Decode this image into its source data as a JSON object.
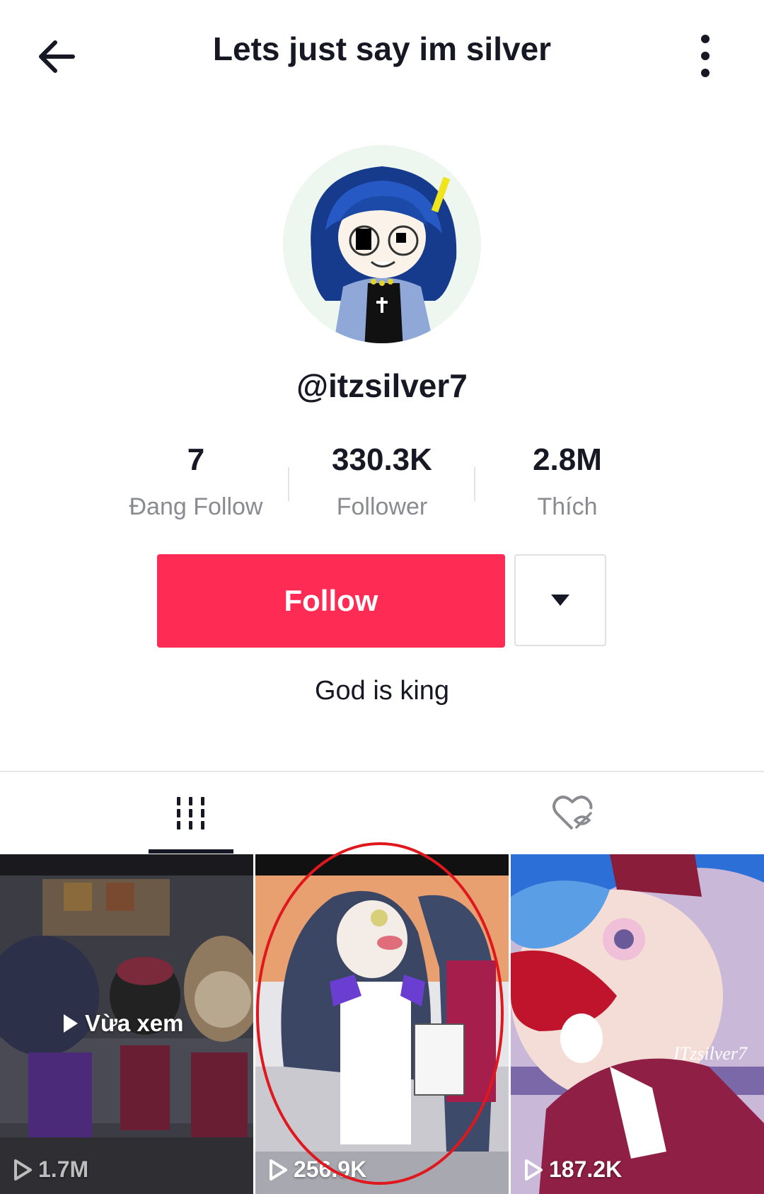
{
  "header": {
    "title": "Lets just say im silver",
    "back_icon": "arrow-left-icon",
    "more_icon": "more-vertical-icon"
  },
  "profile": {
    "handle": "@itzsilver7",
    "bio": "God is king"
  },
  "stats": [
    {
      "value": "7",
      "label": "Đang Follow"
    },
    {
      "value": "330.3K",
      "label": "Follower"
    },
    {
      "value": "2.8M",
      "label": "Thích"
    }
  ],
  "actions": {
    "follow_label": "Follow",
    "follow_color": "#fe2c55",
    "dropdown_icon": "caret-down-icon"
  },
  "tabs": [
    {
      "icon": "videos-grid-icon",
      "active": true
    },
    {
      "icon": "liked-hidden-icon",
      "active": false
    }
  ],
  "videos": [
    {
      "views": "1.7M",
      "overlay": "Vừa xem"
    },
    {
      "views": "256.9K"
    },
    {
      "views": "187.2K",
      "watermark": "ITzsilver7"
    }
  ],
  "annotation": {
    "color": "#e0171c"
  }
}
